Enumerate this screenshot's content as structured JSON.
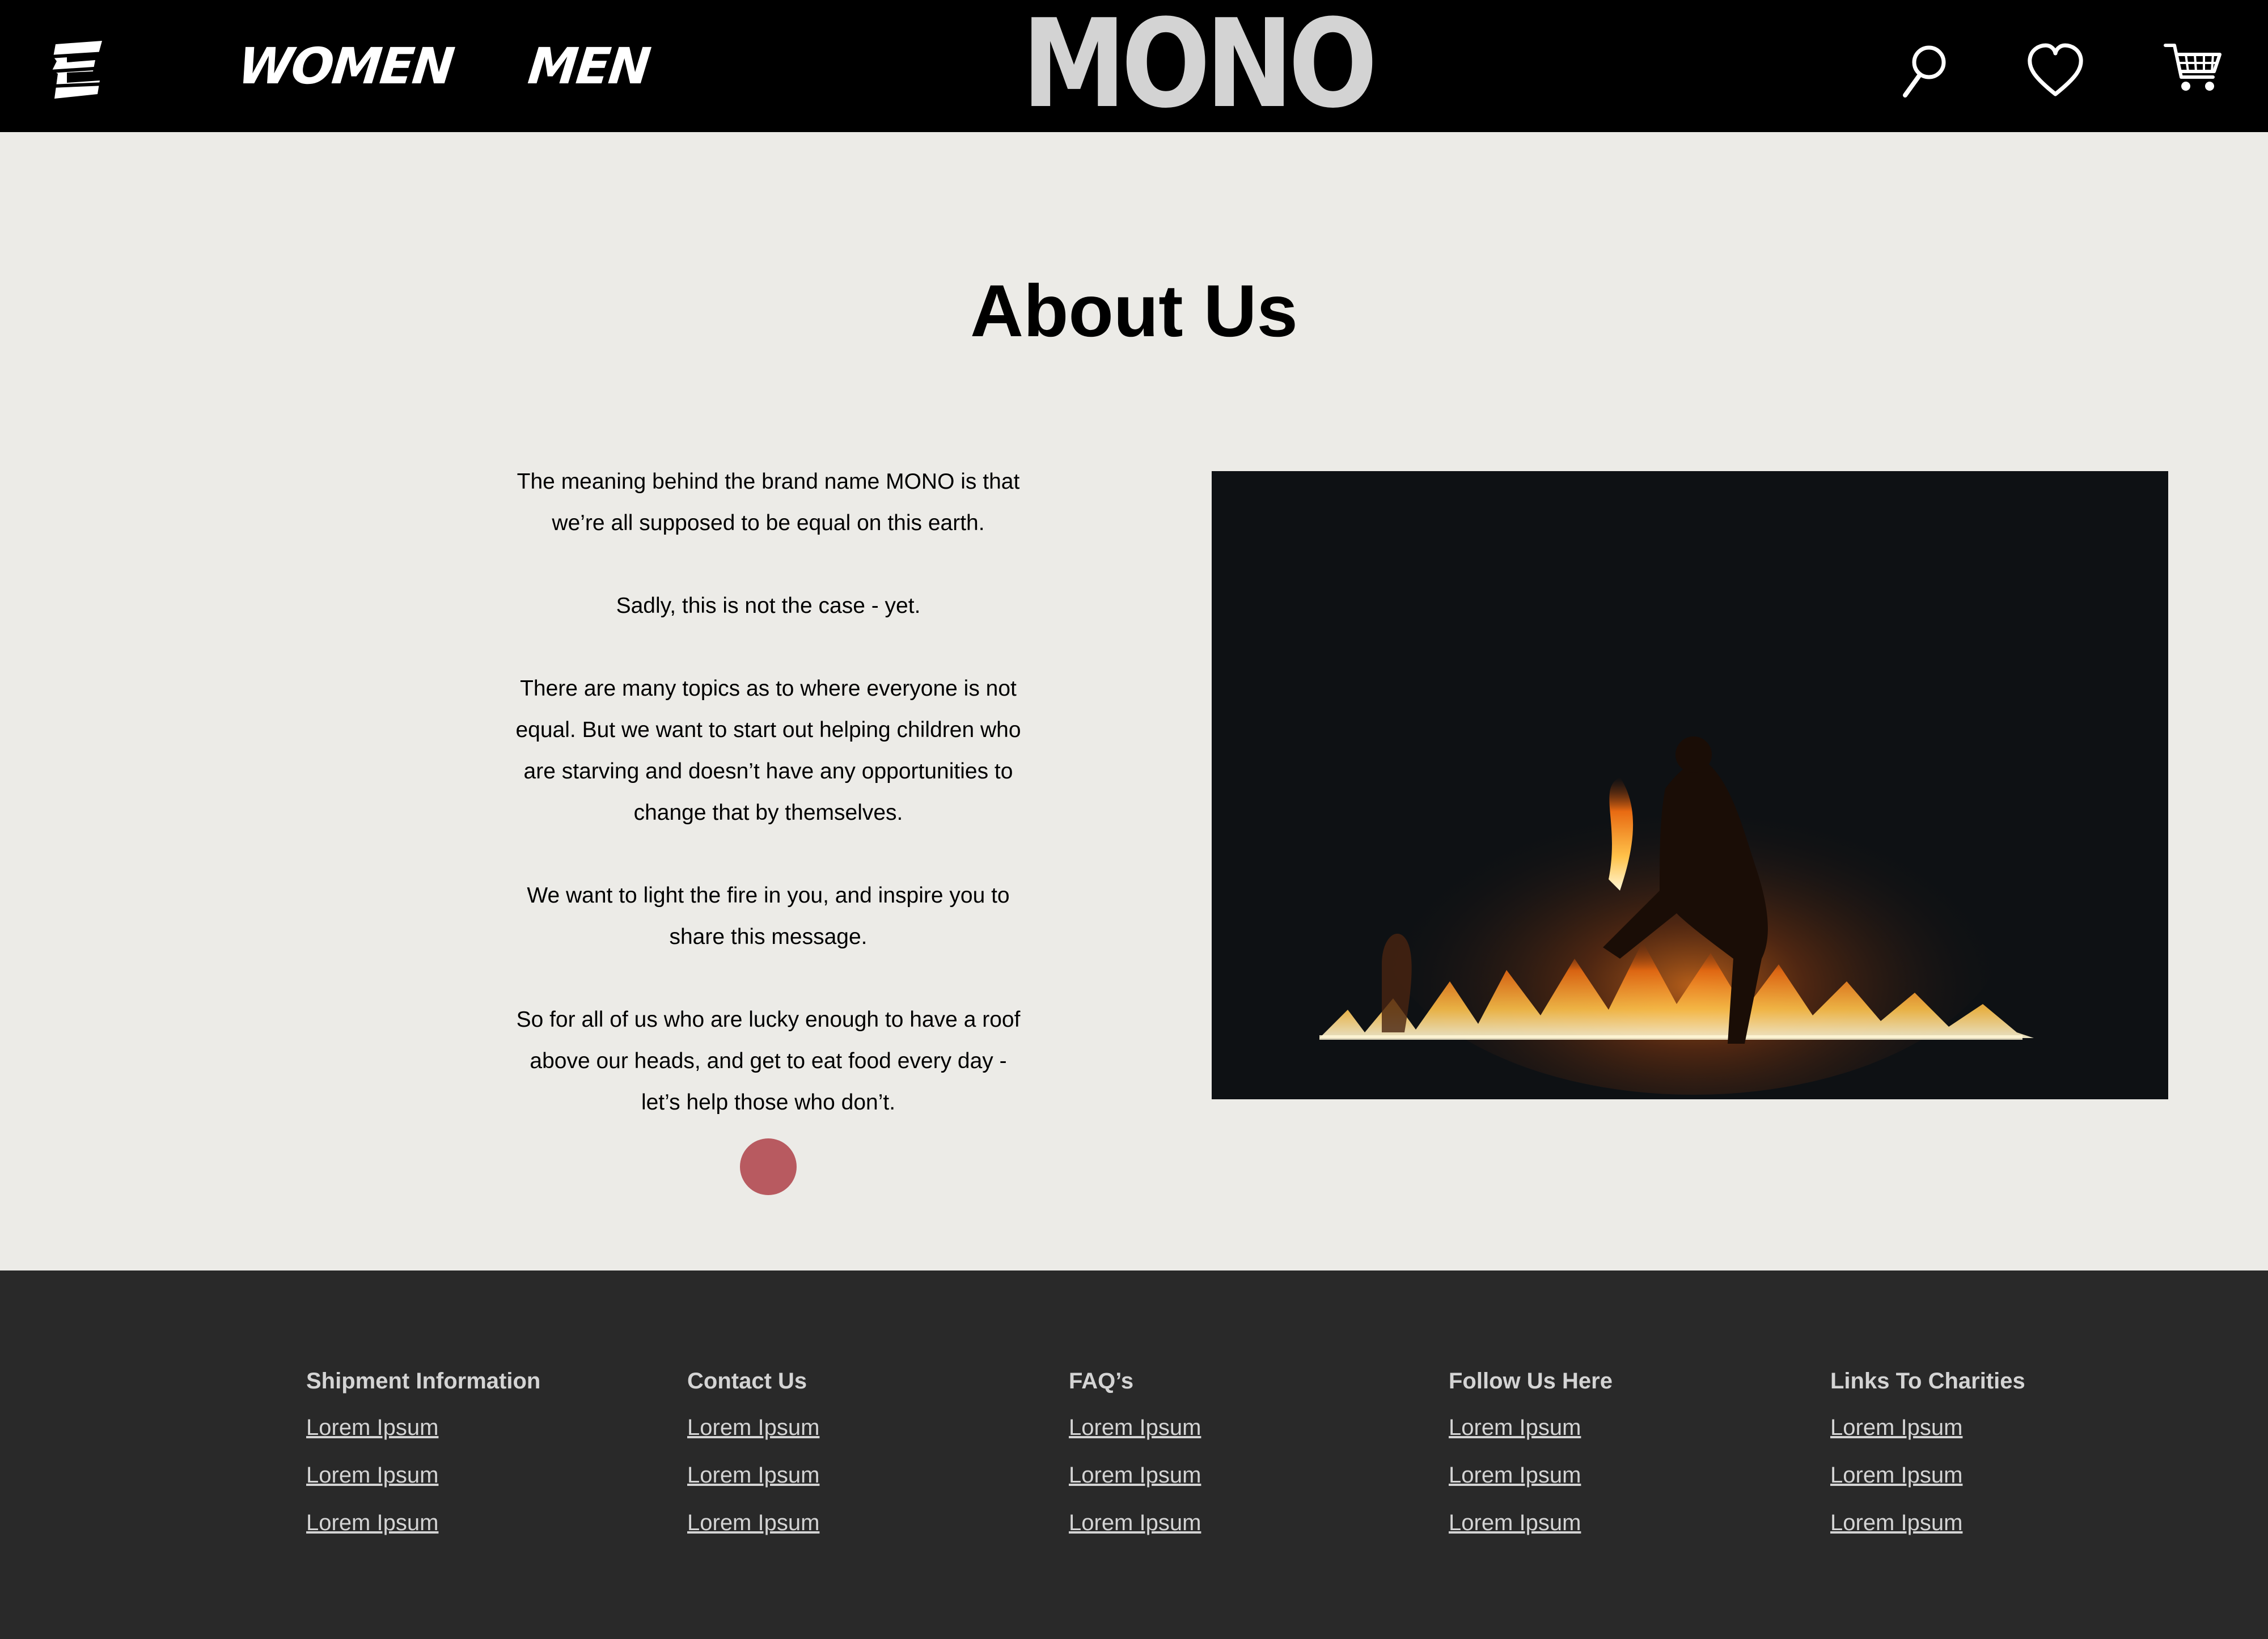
{
  "header": {
    "logo": "MONO",
    "nav": {
      "women": "WOMEN",
      "men": "MEN"
    },
    "icons": {
      "menu": "menu-icon",
      "search": "search-icon",
      "wishlist": "heart-icon",
      "cart": "cart-icon"
    }
  },
  "main": {
    "title": "About Us",
    "paragraphs": [
      "The meaning behind the brand name MONO is that we’re all supposed to be equal on this earth.",
      "Sadly, this is not the case - yet.",
      "There are many topics as to where everyone is not equal. But we want to start out helping children who are starving and doesn’t have any opportunities to change that by themselves.",
      "We want to light the fire in you, and inspire you to share this message.",
      "So for all of us who are lucky enough to have a roof above our heads, and get to eat food every day - let’s help those who don’t."
    ],
    "accent_color": "#b85a60"
  },
  "footer": {
    "columns": [
      {
        "heading": "Shipment Information",
        "links": [
          "Lorem Ipsum",
          "Lorem Ipsum",
          "Lorem Ipsum"
        ]
      },
      {
        "heading": "Contact Us",
        "links": [
          "Lorem Ipsum",
          "Lorem Ipsum",
          "Lorem Ipsum"
        ]
      },
      {
        "heading": "FAQ’s",
        "links": [
          "Lorem Ipsum",
          "Lorem Ipsum",
          "Lorem Ipsum"
        ]
      },
      {
        "heading": "Follow Us Here",
        "links": [
          "Lorem Ipsum",
          "Lorem Ipsum",
          "Lorem Ipsum"
        ]
      },
      {
        "heading": "Links To Charities",
        "links": [
          "Lorem Ipsum",
          "Lorem Ipsum",
          "Lorem Ipsum"
        ]
      }
    ]
  }
}
